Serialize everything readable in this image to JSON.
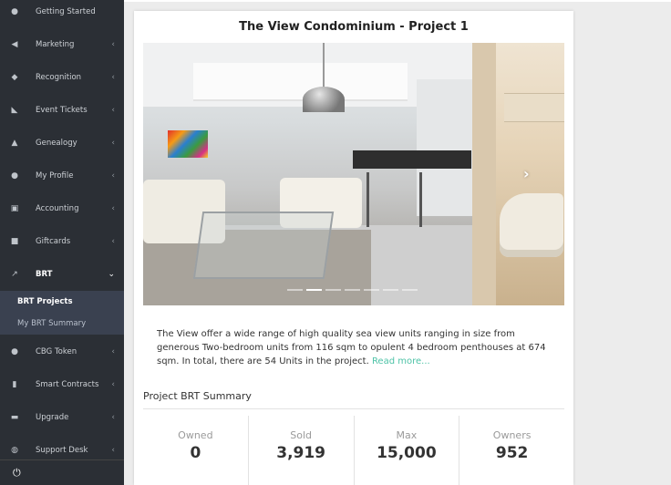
{
  "sidebar": {
    "items": [
      {
        "label": "Getting Started",
        "icon": "user-circle-icon",
        "glyph": "●",
        "has_chevron": false
      },
      {
        "label": "Marketing",
        "icon": "megaphone-icon",
        "glyph": "◀",
        "has_chevron": true
      },
      {
        "label": "Recognition",
        "icon": "diamond-icon",
        "glyph": "◆",
        "has_chevron": true
      },
      {
        "label": "Event Tickets",
        "icon": "tag-icon",
        "glyph": "◣",
        "has_chevron": true
      },
      {
        "label": "Genealogy",
        "icon": "sitemap-icon",
        "glyph": "▲",
        "has_chevron": true
      },
      {
        "label": "My Profile",
        "icon": "user-icon",
        "glyph": "●",
        "has_chevron": true
      },
      {
        "label": "Accounting",
        "icon": "money-icon",
        "glyph": "▣",
        "has_chevron": true
      },
      {
        "label": "Giftcards",
        "icon": "gift-icon",
        "glyph": "■",
        "has_chevron": true
      },
      {
        "label": "BRT",
        "icon": "line-chart-icon",
        "glyph": "↗",
        "has_chevron": true,
        "open": true
      },
      {
        "label": "CBG Token",
        "icon": "coin-icon",
        "glyph": "●",
        "has_chevron": true
      },
      {
        "label": "Smart Contracts",
        "icon": "bar-chart-icon",
        "glyph": "▮",
        "has_chevron": true
      },
      {
        "label": "Upgrade",
        "icon": "car-icon",
        "glyph": "▬",
        "has_chevron": true
      },
      {
        "label": "Support Desk",
        "icon": "globe-icon",
        "glyph": "◍",
        "has_chevron": true
      }
    ],
    "sub_items": [
      {
        "label": "BRT Projects",
        "active": true
      },
      {
        "label": "My BRT Summary",
        "active": false
      }
    ],
    "chevron_glyph": "‹",
    "open_chevron_glyph": "⌄",
    "power_glyph": "⏻"
  },
  "project": {
    "title": "The View Condominium - Project 1",
    "description": "The View offer a wide range of high quality sea view units ranging in size from generous Two-bedroom units from 116 sqm to opulent 4 bedroom penthouses at 674 sqm. In total, there are 54 Units in the project.",
    "read_more": "Read more...",
    "carousel": {
      "slide_count": 7,
      "active_index": 1,
      "next_glyph": "›"
    }
  },
  "summary": {
    "title": "Project BRT Summary",
    "stats": [
      {
        "label": "Owned",
        "value": "0"
      },
      {
        "label": "Sold",
        "value": "3,919"
      },
      {
        "label": "Max",
        "value": "15,000"
      },
      {
        "label": "Owners",
        "value": "952"
      }
    ]
  }
}
